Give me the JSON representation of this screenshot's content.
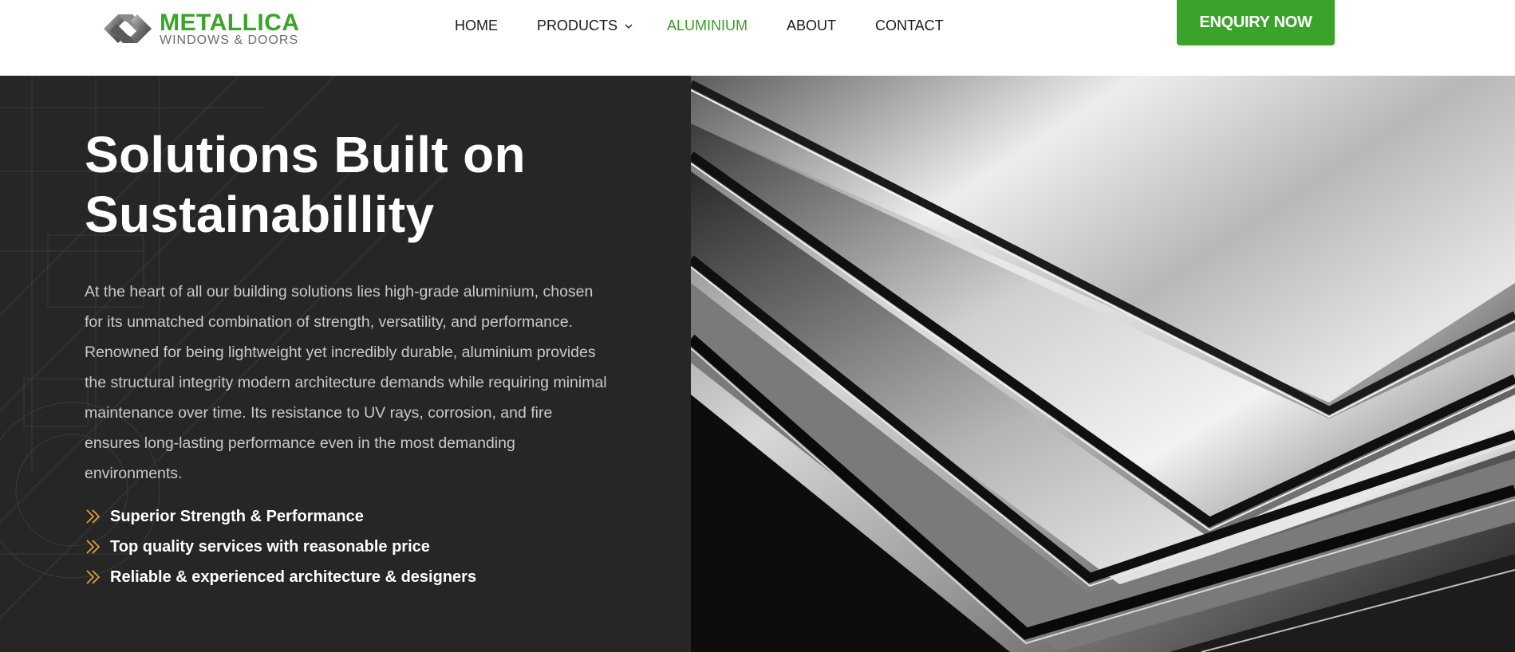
{
  "brand": {
    "name": "METALLICA",
    "tagline": "WINDOWS & DOORS"
  },
  "nav": {
    "items": [
      {
        "label": "HOME"
      },
      {
        "label": "PRODUCTS"
      },
      {
        "label": "ALUMINIUM",
        "active": true
      },
      {
        "label": "ABOUT"
      },
      {
        "label": "CONTACT"
      }
    ]
  },
  "cta": {
    "label": "ENQUIRY NOW"
  },
  "hero": {
    "title_line1": "Solutions Built on",
    "title_line2": "Sustainabillity",
    "body": "At the heart of all our building solutions lies high-grade aluminium, chosen for its unmatched combination of strength, versatility, and performance. Renowned for being lightweight yet incredibly durable, aluminium provides the structural integrity modern architecture demands while requiring minimal maintenance over time. Its resistance to UV rays, corrosion, and fire ensures long-lasting performance even in the most demanding environments.",
    "features": [
      {
        "label": "Superior Strength & Performance",
        "icon": "double-chevron-right-icon"
      },
      {
        "label": "Top quality services with reasonable price",
        "icon": "double-chevron-right-icon"
      },
      {
        "label": "Reliable & experienced architecture & designers",
        "icon": "double-chevron-right-icon"
      }
    ]
  },
  "colors": {
    "brand_green": "#3aa329",
    "nav_active": "#3a9a2a",
    "hero_bg": "#262626",
    "feature_icon": "#e8a93a"
  },
  "icons": {
    "logo_mark": "metallica-logo-icon",
    "products_dropdown": "chevron-down-icon"
  }
}
